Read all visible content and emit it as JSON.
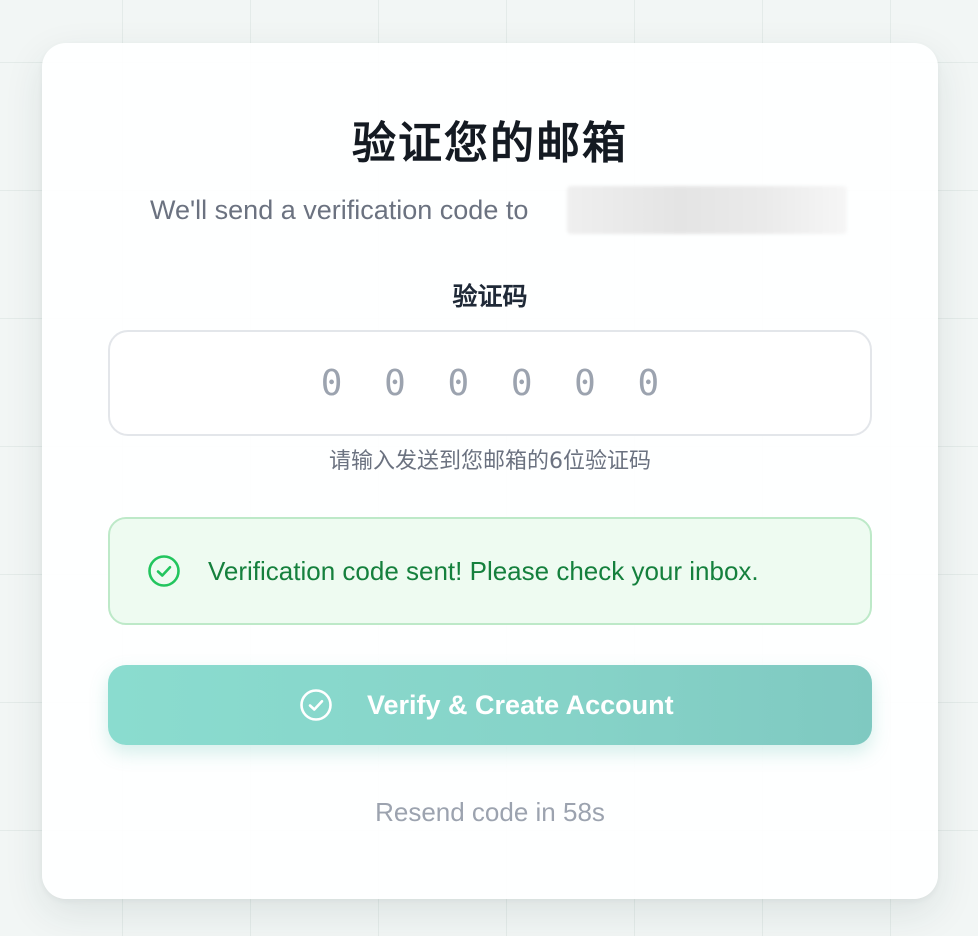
{
  "card": {
    "title": "验证您的邮箱",
    "subtitle": "We'll send a verification code to",
    "code_label": "验证码",
    "code_input": {
      "value": "",
      "placeholder": "0 0 0 0 0 0"
    },
    "code_hint": "请输入发送到您邮箱的6位验证码",
    "success_alert": {
      "icon": "check-circle-icon",
      "text": "Verification code sent! Please check your inbox."
    },
    "verify_button": {
      "icon": "check-circle-icon",
      "label": "Verify & Create Account"
    },
    "resend_text": "Resend code in 58s"
  },
  "colors": {
    "accent": "#86d3c8",
    "success_text": "#15803d",
    "success_bg": "#eefbf1",
    "success_border": "#bde9c8"
  }
}
